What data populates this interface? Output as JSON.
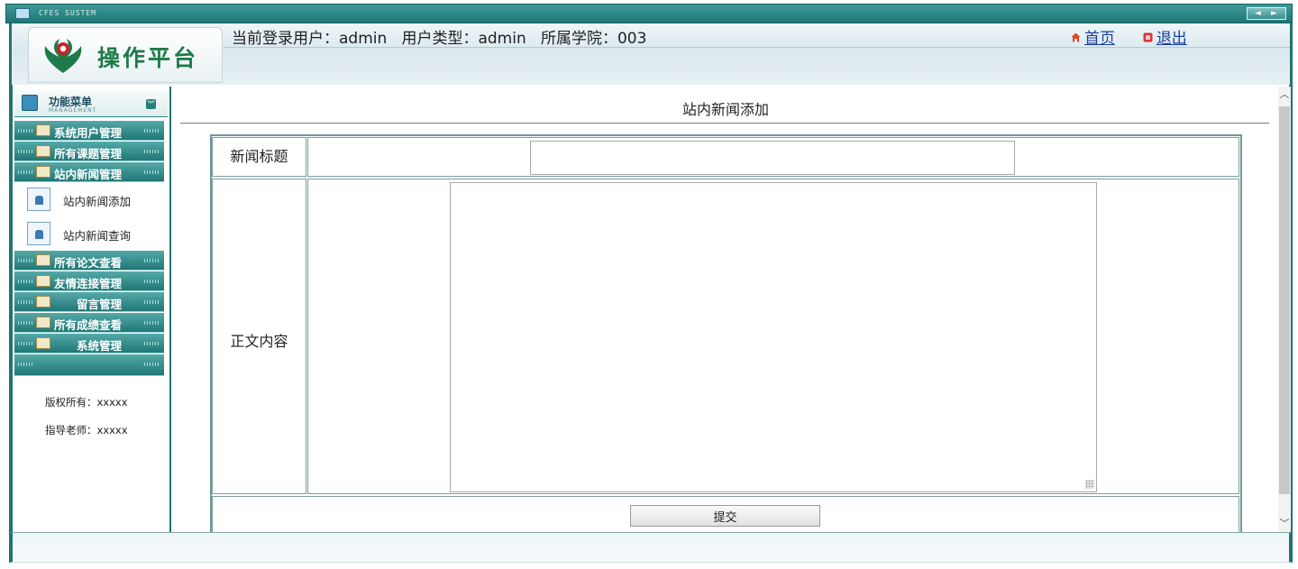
{
  "window": {
    "title": "CFES SUSTEM"
  },
  "header": {
    "logo_text": "操作平台",
    "user_info": "当前登录用户：admin   用户类型：admin   所属学院：003",
    "links": {
      "home": "首页",
      "logout": "退出"
    }
  },
  "sidebar": {
    "menu_title": "功能菜单",
    "menu_subtitle": "MANAGEMENT",
    "items": [
      {
        "label": "系统用户管理"
      },
      {
        "label": "所有课题管理"
      },
      {
        "label": "站内新闻管理"
      },
      {
        "label": "所有论文查看"
      },
      {
        "label": "友情连接管理"
      },
      {
        "label": "留言管理"
      },
      {
        "label": "所有成绩查看"
      },
      {
        "label": "系统管理"
      }
    ],
    "subitems": [
      {
        "label": "站内新闻添加"
      },
      {
        "label": "站内新闻查询"
      }
    ],
    "copyright": "版权所有：xxxxx",
    "advisor": "指导老师：xxxxx"
  },
  "main": {
    "page_title": "站内新闻添加",
    "form": {
      "title_label": "新闻标题",
      "title_value": "",
      "body_label": "正文内容",
      "body_value": "",
      "submit_label": "提交"
    }
  },
  "colors": {
    "accent": "#1f7473",
    "link": "#1a3fa0",
    "logo": "#1e7a4a"
  }
}
